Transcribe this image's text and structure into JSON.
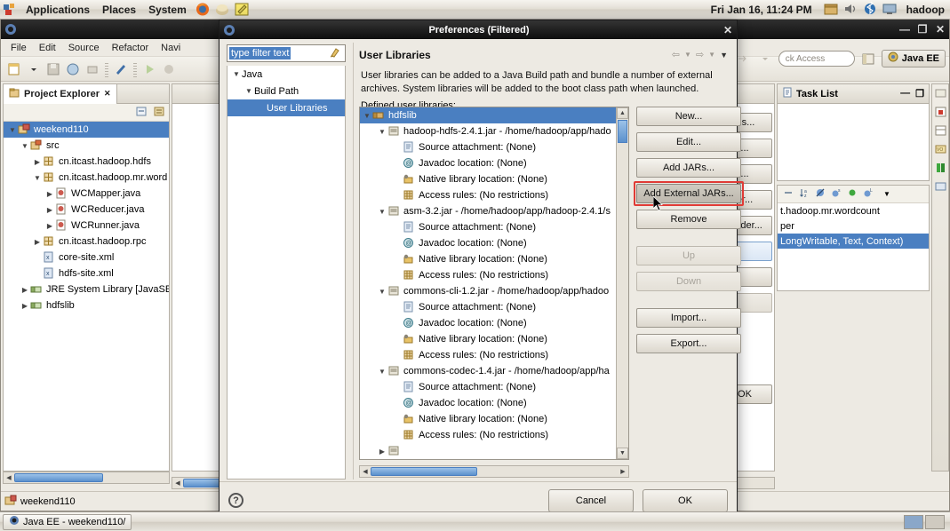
{
  "desktop": {
    "panel_menus": [
      "Applications",
      "Places",
      "System"
    ],
    "panel_icons": [
      "firefox-icon",
      "help-icon",
      "text-editor-icon"
    ],
    "clock": "Fri Jan 16, 11:24 PM",
    "tray_icons": [
      "archive-icon",
      "volume-icon",
      "bluetooth-icon",
      "display-icon"
    ],
    "user": "hadoop"
  },
  "eclipse": {
    "menus": [
      "File",
      "Edit",
      "Source",
      "Refactor",
      "Navi"
    ],
    "quick_access": "ck Access",
    "perspective": "Java EE",
    "window_buttons": [
      "minimize",
      "maximize",
      "close"
    ],
    "project_explorer": {
      "tab_label": "Project Explorer",
      "tab_close": "✕",
      "tree": [
        {
          "label": "weekend110",
          "depth": 0,
          "arrow": "open",
          "icon": "java-project-icon",
          "selected": true
        },
        {
          "label": "src",
          "depth": 1,
          "arrow": "open",
          "icon": "source-folder-icon",
          "selected": false
        },
        {
          "label": "cn.itcast.hadoop.hdfs",
          "depth": 2,
          "arrow": "closed",
          "icon": "package-icon",
          "selected": false
        },
        {
          "label": "cn.itcast.hadoop.mr.word",
          "depth": 2,
          "arrow": "open",
          "icon": "package-icon",
          "selected": false
        },
        {
          "label": "WCMapper.java",
          "depth": 3,
          "arrow": "closed",
          "icon": "java-file-icon",
          "selected": false
        },
        {
          "label": "WCReducer.java",
          "depth": 3,
          "arrow": "closed",
          "icon": "java-file-icon",
          "selected": false
        },
        {
          "label": "WCRunner.java",
          "depth": 3,
          "arrow": "closed",
          "icon": "java-file-icon",
          "selected": false
        },
        {
          "label": "cn.itcast.hadoop.rpc",
          "depth": 2,
          "arrow": "closed",
          "icon": "package-icon",
          "selected": false
        },
        {
          "label": "core-site.xml",
          "depth": 2,
          "arrow": "none",
          "icon": "xml-file-icon",
          "selected": false
        },
        {
          "label": "hdfs-site.xml",
          "depth": 2,
          "arrow": "none",
          "icon": "xml-file-icon",
          "selected": false
        },
        {
          "label": "JRE System Library [JavaSE",
          "depth": 1,
          "arrow": "closed",
          "icon": "library-icon",
          "selected": false
        },
        {
          "label": "hdfslib",
          "depth": 1,
          "arrow": "closed",
          "icon": "library-icon",
          "selected": false
        }
      ]
    },
    "task_list": {
      "tab_label": "Task List"
    },
    "outline": {
      "rows": [
        {
          "label": "t.hadoop.mr.wordcount",
          "selected": false
        },
        {
          "label": "per",
          "selected": false
        },
        {
          "label": "LongWritable, Text, Context)",
          "selected": true
        }
      ]
    },
    "status": {
      "project": "weekend110"
    },
    "taskbar": {
      "window": "Java EE - weekend110/"
    }
  },
  "prefs": {
    "title": "Preferences (Filtered)",
    "close_label": "✕",
    "filter": {
      "value": "type filter text",
      "placeholder": "type filter text"
    },
    "filter_icon": "clear-filter-icon",
    "nav_icons": [
      "back-icon",
      "forward-icon",
      "menu-icon"
    ],
    "left_tree": [
      {
        "label": "Java",
        "depth": 0,
        "arrow": "open",
        "selected": false
      },
      {
        "label": "Build Path",
        "depth": 1,
        "arrow": "open",
        "selected": false
      },
      {
        "label": "User Libraries",
        "depth": 2,
        "arrow": "none",
        "selected": true
      }
    ],
    "page_title": "User Libraries",
    "description_line1": "User libraries can be added to a Java Build path and bundle a number of external",
    "description_line2": "archives. System libraries will be added to the boot class path when launched.",
    "defined_label": "Defined user libraries:",
    "library_tree": [
      {
        "label": "hdfslib",
        "depth": 0,
        "arrow": "open",
        "icon": "user-library-icon",
        "selected": true
      },
      {
        "label": "hadoop-hdfs-2.4.1.jar - /home/hadoop/app/hado",
        "depth": 1,
        "arrow": "open",
        "icon": "jar-icon",
        "selected": false
      },
      {
        "label": "Source attachment: (None)",
        "depth": 2,
        "arrow": "none",
        "icon": "source-attachment-icon",
        "selected": false
      },
      {
        "label": "Javadoc location: (None)",
        "depth": 2,
        "arrow": "none",
        "icon": "javadoc-icon",
        "selected": false
      },
      {
        "label": "Native library location: (None)",
        "depth": 2,
        "arrow": "none",
        "icon": "native-library-icon",
        "selected": false
      },
      {
        "label": "Access rules: (No restrictions)",
        "depth": 2,
        "arrow": "none",
        "icon": "access-rules-icon",
        "selected": false
      },
      {
        "label": "asm-3.2.jar - /home/hadoop/app/hadoop-2.4.1/s",
        "depth": 1,
        "arrow": "open",
        "icon": "jar-icon",
        "selected": false
      },
      {
        "label": "Source attachment: (None)",
        "depth": 2,
        "arrow": "none",
        "icon": "source-attachment-icon",
        "selected": false
      },
      {
        "label": "Javadoc location: (None)",
        "depth": 2,
        "arrow": "none",
        "icon": "javadoc-icon",
        "selected": false
      },
      {
        "label": "Native library location: (None)",
        "depth": 2,
        "arrow": "none",
        "icon": "native-library-icon",
        "selected": false
      },
      {
        "label": "Access rules: (No restrictions)",
        "depth": 2,
        "arrow": "none",
        "icon": "access-rules-icon",
        "selected": false
      },
      {
        "label": "commons-cli-1.2.jar - /home/hadoop/app/hadoo",
        "depth": 1,
        "arrow": "open",
        "icon": "jar-icon",
        "selected": false
      },
      {
        "label": "Source attachment: (None)",
        "depth": 2,
        "arrow": "none",
        "icon": "source-attachment-icon",
        "selected": false
      },
      {
        "label": "Javadoc location: (None)",
        "depth": 2,
        "arrow": "none",
        "icon": "javadoc-icon",
        "selected": false
      },
      {
        "label": "Native library location: (None)",
        "depth": 2,
        "arrow": "none",
        "icon": "native-library-icon",
        "selected": false
      },
      {
        "label": "Access rules: (No restrictions)",
        "depth": 2,
        "arrow": "none",
        "icon": "access-rules-icon",
        "selected": false
      },
      {
        "label": "commons-codec-1.4.jar - /home/hadoop/app/ha",
        "depth": 1,
        "arrow": "open",
        "icon": "jar-icon",
        "selected": false
      },
      {
        "label": "Source attachment: (None)",
        "depth": 2,
        "arrow": "none",
        "icon": "source-attachment-icon",
        "selected": false
      },
      {
        "label": "Javadoc location: (None)",
        "depth": 2,
        "arrow": "none",
        "icon": "javadoc-icon",
        "selected": false
      },
      {
        "label": "Native library location: (None)",
        "depth": 2,
        "arrow": "none",
        "icon": "native-library-icon",
        "selected": false
      },
      {
        "label": "Access rules: (No restrictions)",
        "depth": 2,
        "arrow": "none",
        "icon": "access-rules-icon",
        "selected": false
      }
    ],
    "buttons": [
      {
        "label": "New...",
        "state": "normal"
      },
      {
        "label": "Edit...",
        "state": "normal"
      },
      {
        "label": "Add JARs...",
        "state": "normal"
      },
      {
        "label": "Add External JARs...",
        "state": "pressed"
      },
      {
        "label": "Remove",
        "state": "normal"
      },
      {
        "label": "Up",
        "state": "disabled"
      },
      {
        "label": "Down",
        "state": "disabled"
      },
      {
        "label": "Import...",
        "state": "normal"
      },
      {
        "label": "Export...",
        "state": "normal"
      }
    ],
    "highlight_color": "#e03b36",
    "help_icon": "help-icon",
    "cancel_label": "Cancel",
    "ok_label": "OK"
  },
  "behind_dialog": {
    "buttons": [
      "Rs...",
      "...",
      "...",
      "er...",
      "Folder...",
      "",
      "",
      ""
    ],
    "ok_label": "OK"
  }
}
